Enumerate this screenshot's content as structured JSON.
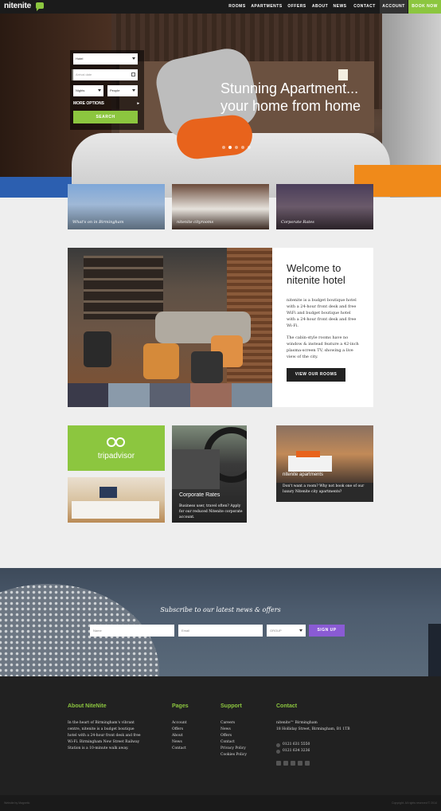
{
  "nav": {
    "logo": "nitenite",
    "items": [
      "ROOMS",
      "APARTMENTS",
      "OFFERS",
      "ABOUT",
      "NEWS",
      "CONTACT"
    ],
    "account": "ACCOUNT",
    "book": "BOOK NOW"
  },
  "hero": {
    "headline": "Stunning Apartment... your home from home",
    "slides": 5,
    "active_slide": 2
  },
  "booking": {
    "hotel": "Hotel",
    "arrival_placeholder": "Arrival date",
    "nights": "Nights",
    "people": "People",
    "more_options": "MORE OPTIONS",
    "search": "SEARCH"
  },
  "tiles": [
    {
      "label": "What's on in Birmingham"
    },
    {
      "label": "nitenite cityrooms"
    },
    {
      "label": "Corporate Rates"
    }
  ],
  "welcome": {
    "title": "Welcome to nitenite hotel",
    "p1": "nitenite is a budget boutique hotel with a 24-hour front desk and free WiFi and budget boutique hotel with a 24-hour front desk and free Wi-Fi.",
    "p2": "The cabin-style rooms have no window & instead feature a 42-inch plasma-screen TV, showing a live view of the city.",
    "button": "VIEW OUR ROOMS"
  },
  "features": {
    "tripadvisor": "tripadvisor",
    "corporate_title": "Corporate Rates",
    "corporate_desc": "Business user, travel often? Apply for our reduced Nitenite corporate account.",
    "apartments_title": "nitenite apartments",
    "apartments_desc": "Don't want a room? Why not book one of our luxury Nitenite city apartments?"
  },
  "subscribe": {
    "title": "Subscribe to our latest news & offers",
    "name_placeholder": "Name",
    "email_placeholder": "Email",
    "group": "GROUP",
    "button": "SIGN UP"
  },
  "footer": {
    "about_title": "About NiteNite",
    "about_text": "In the heart of Birmingham's vibrant centre, nitenite is a budget boutique hotel with a 24-hour front desk and free Wi-Fi. Birmingham New Street Railway Station is a 10-minute walk away.",
    "pages_title": "Pages",
    "pages": [
      "Account",
      "Offers",
      "About",
      "News",
      "Contact"
    ],
    "support_title": "Support",
    "support": [
      "Careers",
      "News",
      "Offers",
      "Contact",
      "Privacy Policy",
      "Cookies Policy"
    ],
    "contact_title": "Contact",
    "address_1": "nitenite™ Birmingham",
    "address_2": "18 Holliday Street, Birmingham, B1 1TB",
    "phone": "0121 631 5550",
    "fax": "0121 634 3236",
    "bottom_left": "Website by Magnetic",
    "bottom_right": "Copyright. All rights reserved © 2014"
  }
}
